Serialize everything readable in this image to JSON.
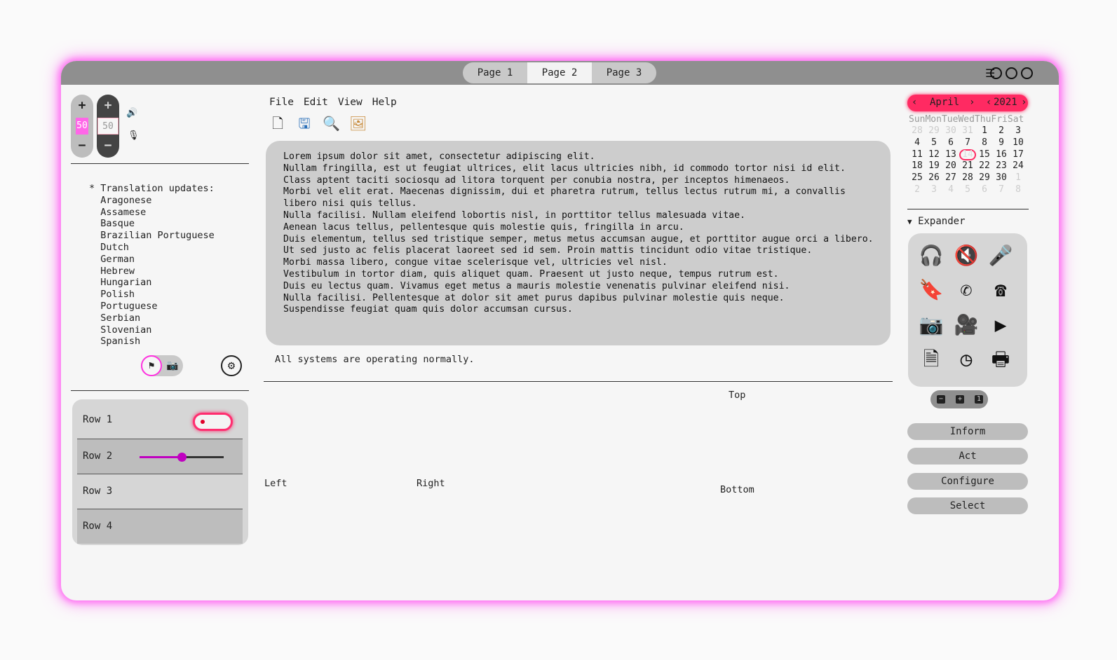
{
  "tabs": [
    "Page 1",
    "Page 2",
    "Page 3"
  ],
  "active_tab": "Page 2",
  "window_controls": {
    "menu_icon": "hamburger-icon"
  },
  "volume": {
    "left_value": "50",
    "right_value": "50",
    "plus": "+",
    "minus": "−"
  },
  "translations": {
    "text": "* Translation updates:\n  Aragonese\n  Assamese\n  Basque\n  Brazilian Portuguese\n  Dutch\n  German\n  Hebrew\n  Hungarian\n  Polish\n  Portuguese\n  Serbian\n  Slovenian\n  Spanish"
  },
  "list_rows": [
    "Row 1",
    "Row 2",
    "Row 3",
    "Row 4"
  ],
  "slider": {
    "value": 0.5
  },
  "menu": [
    "File",
    "Edit",
    "View",
    "Help"
  ],
  "text_content": "Lorem ipsum dolor sit amet, consectetur adipiscing elit.\nNullam fringilla, est ut feugiat ultrices, elit lacus ultricies nibh, id commodo tortor nisi id elit.\nClass aptent taciti sociosqu ad litora torquent per conubia nostra, per inceptos himenaeos.\nMorbi vel elit erat. Maecenas dignissim, dui et pharetra rutrum, tellus lectus rutrum mi, a convallis\nlibero nisi quis tellus.\nNulla facilisi. Nullam eleifend lobortis nisl, in porttitor tellus malesuada vitae.\nAenean lacus tellus, pellentesque quis molestie quis, fringilla in arcu.\nDuis elementum, tellus sed tristique semper, metus metus accumsan augue, et porttitor augue orci a libero.\nUt sed justo ac felis placerat laoreet sed id sem. Proin mattis tincidunt odio vitae tristique.\nMorbi massa libero, congue vitae scelerisque vel, ultricies vel nisl.\nVestibulum in tortor diam, quis aliquet quam. Praesent ut justo neque, tempus rutrum est.\nDuis eu lectus quam. Vivamus eget metus a mauris molestie venenatis pulvinar eleifend nisi.\nNulla facilisi. Pellentesque at dolor sit amet purus dapibus pulvinar molestie quis neque.\nSuspendisse feugiat quam quis dolor accumsan cursus.",
  "status": "All systems are operating normally.",
  "positions": {
    "top": "Top",
    "left": "Left",
    "right": "Right",
    "bottom": "Bottom"
  },
  "calendar": {
    "month": "April",
    "year": "2021",
    "day_names": "SunMonTueWedThuFriSat",
    "weeks": [
      [
        [
          "28",
          "dim"
        ],
        [
          "29",
          "dim"
        ],
        [
          "30",
          "dim"
        ],
        [
          "31",
          "dim"
        ],
        [
          "1",
          ""
        ],
        [
          "2",
          ""
        ],
        [
          "3",
          ""
        ]
      ],
      [
        [
          "4",
          ""
        ],
        [
          "5",
          ""
        ],
        [
          "6",
          ""
        ],
        [
          "7",
          ""
        ],
        [
          "8",
          ""
        ],
        [
          "9",
          ""
        ],
        [
          "10",
          ""
        ]
      ],
      [
        [
          "11",
          ""
        ],
        [
          "12",
          ""
        ],
        [
          "13",
          ""
        ],
        [
          "14",
          "today"
        ],
        [
          "15",
          ""
        ],
        [
          "16",
          ""
        ],
        [
          "17",
          ""
        ]
      ],
      [
        [
          "18",
          ""
        ],
        [
          "19",
          ""
        ],
        [
          "20",
          ""
        ],
        [
          "21",
          ""
        ],
        [
          "22",
          ""
        ],
        [
          "23",
          ""
        ],
        [
          "24",
          ""
        ]
      ],
      [
        [
          "25",
          ""
        ],
        [
          "26",
          ""
        ],
        [
          "27",
          ""
        ],
        [
          "28",
          ""
        ],
        [
          "29",
          ""
        ],
        [
          "30",
          ""
        ],
        [
          "1",
          "dim"
        ]
      ],
      [
        [
          "2",
          "dim"
        ],
        [
          "3",
          "dim"
        ],
        [
          "4",
          "dim"
        ],
        [
          "5",
          "dim"
        ],
        [
          "6",
          "dim"
        ],
        [
          "7",
          "dim"
        ],
        [
          "8",
          "dim"
        ]
      ]
    ]
  },
  "expander": "Expander",
  "icons": [
    "headphones-icon",
    "speaker-muted-icon",
    "microphone-icon",
    "bookmark-add-icon",
    "phone-icon",
    "hang-up-icon",
    "camera-icon",
    "video-camera-icon",
    "video-icon",
    "document-add-icon",
    "clock-icon",
    "printer-icon"
  ],
  "buttons": [
    "Inform",
    "Act",
    "Configure",
    "Select"
  ],
  "colors": {
    "accent": "#ff2a62",
    "glow": "#ff6bf3",
    "selection": "#c000c0"
  }
}
